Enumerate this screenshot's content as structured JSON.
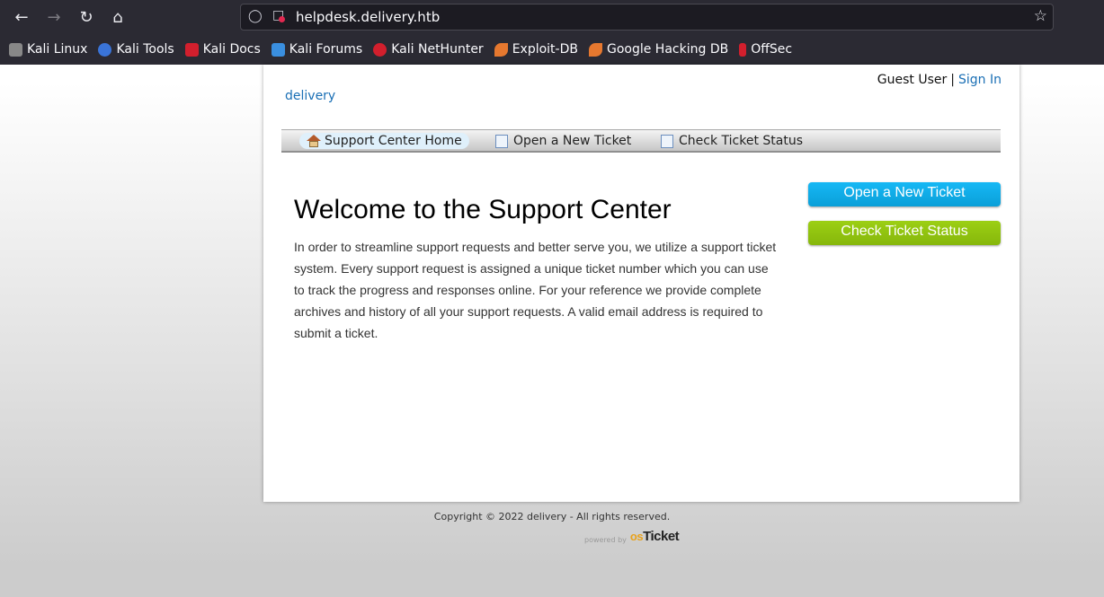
{
  "browser": {
    "url": "helpdesk.delivery.htb",
    "bookmarks": [
      {
        "label": "Kali Linux",
        "icon": "kali-dragon-icon",
        "color": "#2b2a33"
      },
      {
        "label": "Kali Tools",
        "icon": "kali-tools-icon",
        "color": "#3a74d8"
      },
      {
        "label": "Kali Docs",
        "icon": "kali-docs-icon",
        "color": "#d21f2d"
      },
      {
        "label": "Kali Forums",
        "icon": "kali-forums-icon",
        "color": "#3a8fe0"
      },
      {
        "label": "Kali NetHunter",
        "icon": "kali-nethunter-icon",
        "color": "#d21f2d"
      },
      {
        "label": "Exploit-DB",
        "icon": "exploit-db-icon",
        "color": "#e6782f"
      },
      {
        "label": "Google Hacking DB",
        "icon": "ghdb-icon",
        "color": "#e6782f"
      },
      {
        "label": "OffSec",
        "icon": "offsec-icon",
        "color": "#d21f2d"
      }
    ]
  },
  "header": {
    "guest_label": "Guest User",
    "separator": "|",
    "sign_in": "Sign In",
    "logo_text": "delivery"
  },
  "nav": {
    "items": [
      {
        "label": "Support Center Home",
        "icon": "home-icon",
        "active": true
      },
      {
        "label": "Open a New Ticket",
        "icon": "new-ticket-icon",
        "active": false
      },
      {
        "label": "Check Ticket Status",
        "icon": "ticket-status-icon",
        "active": false
      }
    ]
  },
  "main": {
    "title": "Welcome to the Support Center",
    "body": "In order to streamline support requests and better serve you, we utilize a support ticket system. Every support request is assigned a unique ticket number which you can use to track the progress and responses online. For your reference we provide complete archives and history of all your support requests. A valid email address is required to submit a ticket."
  },
  "sidebar": {
    "open_ticket": "Open a New Ticket",
    "check_status": "Check Ticket Status",
    "open_color": "#0ca8e6",
    "check_color": "#8fc20d"
  },
  "footer": {
    "copyright": "Copyright © 2022 delivery - All rights reserved.",
    "powered_by": "powered by",
    "brand_os": "os",
    "brand_ticket": "Ticket"
  }
}
